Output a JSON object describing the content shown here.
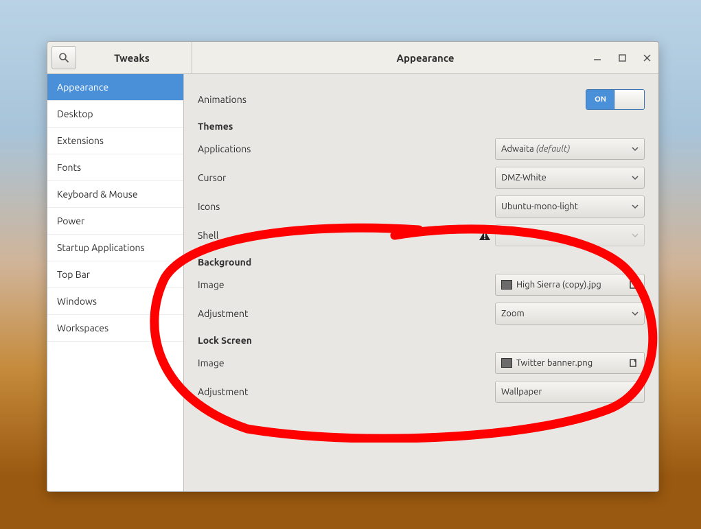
{
  "header": {
    "app_title": "Tweaks",
    "page_title": "Appearance"
  },
  "sidebar": {
    "items": [
      {
        "label": "Appearance",
        "name": "sidebar-item-appearance",
        "active": true
      },
      {
        "label": "Desktop",
        "name": "sidebar-item-desktop"
      },
      {
        "label": "Extensions",
        "name": "sidebar-item-extensions"
      },
      {
        "label": "Fonts",
        "name": "sidebar-item-fonts"
      },
      {
        "label": "Keyboard & Mouse",
        "name": "sidebar-item-keyboard-mouse"
      },
      {
        "label": "Power",
        "name": "sidebar-item-power"
      },
      {
        "label": "Startup Applications",
        "name": "sidebar-item-startup-applications"
      },
      {
        "label": "Top Bar",
        "name": "sidebar-item-top-bar"
      },
      {
        "label": "Windows",
        "name": "sidebar-item-windows"
      },
      {
        "label": "Workspaces",
        "name": "sidebar-item-workspaces"
      }
    ]
  },
  "content": {
    "animations": {
      "label": "Animations",
      "toggle_text": "ON",
      "value": true
    },
    "themes": {
      "section": "Themes",
      "applications": {
        "label": "Applications",
        "value": "Adwaita",
        "default_suffix": "(default)"
      },
      "cursor": {
        "label": "Cursor",
        "value": "DMZ-White"
      },
      "icons": {
        "label": "Icons",
        "value": "Ubuntu-mono-light"
      },
      "shell": {
        "label": "Shell",
        "value": "",
        "disabled": true,
        "warning": true
      }
    },
    "background": {
      "section": "Background",
      "image": {
        "label": "Image",
        "value": "High Sierra (copy).jpg"
      },
      "adjustment": {
        "label": "Adjustment",
        "value": "Zoom"
      }
    },
    "lockscreen": {
      "section": "Lock Screen",
      "image": {
        "label": "Image",
        "value": "Twitter banner.png"
      },
      "adjustment": {
        "label": "Adjustment",
        "value": "Wallpaper"
      }
    }
  },
  "colors": {
    "accent": "#4a90d9",
    "annotation": "#ff0000"
  }
}
